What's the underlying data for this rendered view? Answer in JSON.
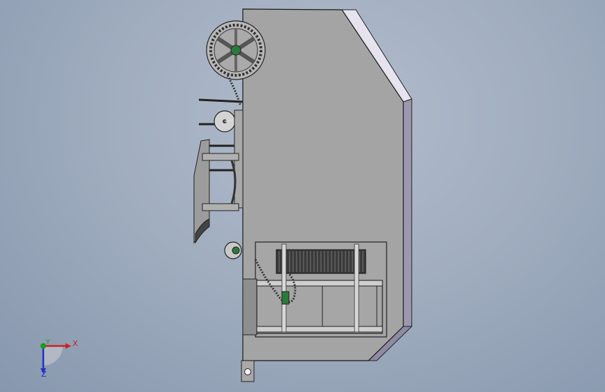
{
  "viewport": {
    "background_top": "#b2bdcc",
    "background_bottom": "#8797ad"
  },
  "model": {
    "body_fill": "#a4a4a4",
    "bevel_fill": "#e6e3ef",
    "side_fill": "#8f8aa3",
    "outline": "#1a1a1a",
    "accent_green": "#2c7a3a"
  },
  "triad": {
    "x_label": "X",
    "y_label": "Y",
    "z_label": "Z",
    "x_color": "#cc2020",
    "y_color": "#1a9a1a",
    "z_color": "#2230c8"
  }
}
